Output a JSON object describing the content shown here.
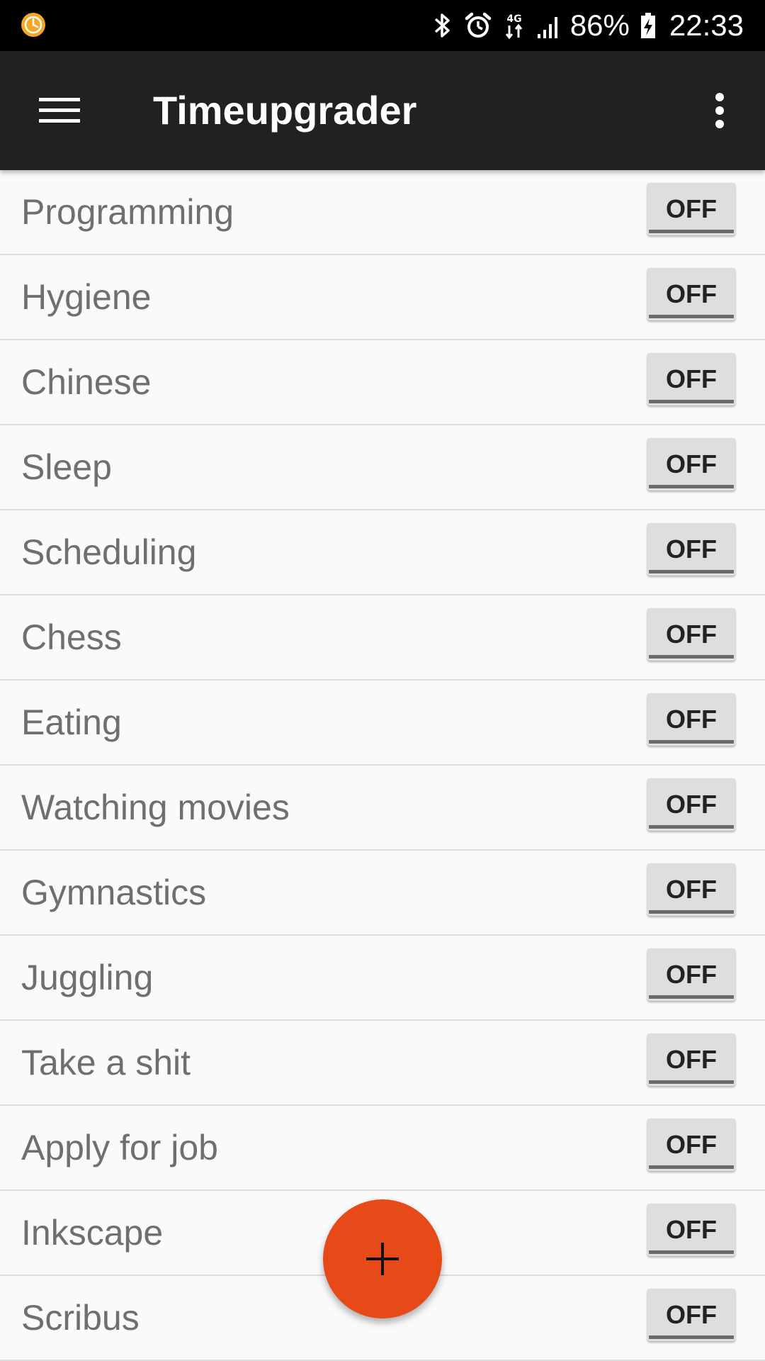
{
  "status_bar": {
    "battery_percent": "86%",
    "time": "22:33",
    "network_type": "4G",
    "icons": [
      "app-notification-icon",
      "bluetooth-icon",
      "alarm-icon",
      "4g-data-icon",
      "signal-icon",
      "battery-charging-icon"
    ]
  },
  "app_bar": {
    "title": "Timeupgrader",
    "menu_icon": "hamburger-menu-icon",
    "overflow_icon": "more-vert-icon"
  },
  "activities": [
    {
      "name": "Programming",
      "state": "OFF"
    },
    {
      "name": "Hygiene",
      "state": "OFF"
    },
    {
      "name": "Chinese",
      "state": "OFF"
    },
    {
      "name": "Sleep",
      "state": "OFF"
    },
    {
      "name": "Scheduling",
      "state": "OFF"
    },
    {
      "name": "Chess",
      "state": "OFF"
    },
    {
      "name": "Eating",
      "state": "OFF"
    },
    {
      "name": "Watching movies",
      "state": "OFF"
    },
    {
      "name": "Gymnastics",
      "state": "OFF"
    },
    {
      "name": "Juggling",
      "state": "OFF"
    },
    {
      "name": "Take a shit",
      "state": "OFF"
    },
    {
      "name": "Apply for job",
      "state": "OFF"
    },
    {
      "name": "Inkscape",
      "state": "OFF"
    },
    {
      "name": "Scribus",
      "state": "OFF"
    }
  ],
  "fab": {
    "icon": "plus-icon"
  },
  "colors": {
    "app_bar": "#212121",
    "fab": "#e64a19",
    "status_bar": "#000000",
    "list_background": "#fafafa",
    "toggle_background": "#dedede"
  }
}
